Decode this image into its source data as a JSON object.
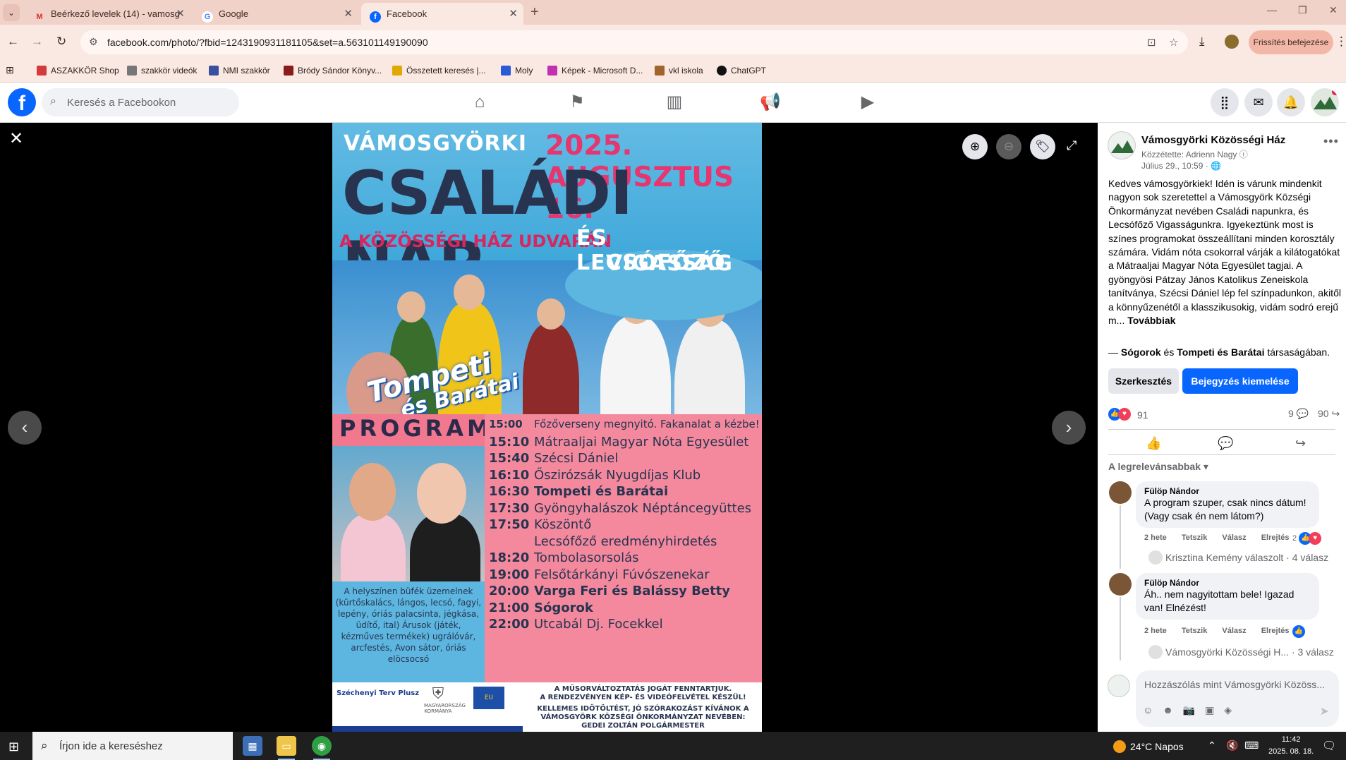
{
  "browser": {
    "tabs": [
      {
        "label": "Beérkező levelek (14) - vamosg",
        "icon": "gmail-icon"
      },
      {
        "label": "Google",
        "icon": "google-icon"
      },
      {
        "label": "Facebook",
        "icon": "facebook-icon"
      }
    ],
    "url": "facebook.com/photo/?fbid=1243190931181105&set=a.563101149190090",
    "refresh_button": "Frissítés befejezése",
    "bookmarks": [
      {
        "label": "ASZAKKÖR Shop",
        "color": "#d33b3b"
      },
      {
        "label": "szakkör videók",
        "color": "#777777"
      },
      {
        "label": "NMI szakkör",
        "color": "#3a4fa0"
      },
      {
        "label": "Bródy Sándor Könyv...",
        "color": "#8b1a1a"
      },
      {
        "label": "Összetett keresés |...",
        "color": "#e0a800"
      },
      {
        "label": "Moly",
        "color": "#2a5bd7"
      },
      {
        "label": "Képek - Microsoft D...",
        "color": "#c22fb0"
      },
      {
        "label": "vkl iskola",
        "color": "#a0652a"
      },
      {
        "label": "ChatGPT",
        "color": "#111111"
      }
    ]
  },
  "facebook": {
    "logo": "f",
    "search_placeholder": "Keresés a Facebookon"
  },
  "poster": {
    "town": "VÁMOSGYÖRKI",
    "date": "2025. AUGUSZTUS 16.",
    "title": "CSALÁDI NAP",
    "venue": "A KÖZÖSSÉGI HÁZ UDVARÁN",
    "sub1": "ÉS LECSÓFŐZŐ",
    "sub2": "VIGASSÁG",
    "logo1": "Tompeti",
    "logo2": "és Barátai",
    "program_label": "PROGRAM",
    "schedule": [
      {
        "time": "15:00",
        "event": "Főzőverseny megnyitó. Fakanalat a kézbe!",
        "bold": false
      },
      {
        "time": "15:10",
        "event": "Mátraaljai Magyar Nóta Egyesület",
        "bold": false
      },
      {
        "time": "15:40",
        "event": "Szécsi Dániel",
        "bold": false
      },
      {
        "time": "16:10",
        "event": "Őszirózsák Nyugdíjas Klub",
        "bold": false
      },
      {
        "time": "16:30",
        "event": "Tompeti és Barátai",
        "bold": true
      },
      {
        "time": "17:30",
        "event": "Gyöngyhalászok Néptáncegyüttes",
        "bold": false
      },
      {
        "time": "17:50",
        "event": "Köszöntő",
        "bold": false
      },
      {
        "time": "",
        "event": "Lecsófőző eredményhirdetés",
        "bold": false
      },
      {
        "time": "18:20",
        "event": "Tombolasorsolás",
        "bold": false
      },
      {
        "time": "19:00",
        "event": "Felsőtárkányi Fúvószenekar",
        "bold": false
      },
      {
        "time": "20:00",
        "event": "Varga Feri és Balássy Betty",
        "bold": true
      },
      {
        "time": "21:00",
        "event": "Sógorok",
        "bold": true
      },
      {
        "time": "22:00",
        "event": "Utcabál Dj. Focekkel",
        "bold": false
      }
    ],
    "info": "A helyszínen büfék üzemelnek (kürtőskalács, lángos, lecsó, fagyi, lepény, óriás palacsinta, jégkása, üdítő, ital) Árusok (játék, kézműves termékek) ugrálóvár, arcfestés, Avon sátor, óriás elöcsocsó",
    "footer_brand": "Széchenyi Terv Plusz",
    "footer_crest": "MAGYARORSZÁG KORMÁNYA",
    "footer_eu": "EU",
    "footer_line1": "A MŰSORVÁLTOZTATÁS JOGÁT FENNTARTJUK.",
    "footer_line2": "A RENDEZVÉNYEN KÉP- ÉS VIDEÓFELVÉTEL KÉSZÜL!",
    "footer_line3": "KELLEMES IDŐTÖLTÉST, JÓ SZÓRAKOZÁST KÍVÁNOK A VÁMOSGYÖRK KÖZSÉGI ÖNKORMÁNYZAT NEVÉBEN:",
    "footer_line4": "GEDEI ZOLTÁN POLGÁRMESTER"
  },
  "post": {
    "page_name": "Vámosgyörki Közösségi Ház",
    "posted_by": "Közzétette: Adrienn Nagy",
    "date": "Július 29., 10:59 ·",
    "text": "Kedves vámosgyörkiek! Idén is várunk mindenkit nagyon sok szeretettel a Vámosgyörk Községi Önkormányzat nevében Családi napunkra, és Lecsófőző Vigasságunkra. Igyekeztünk most is színes programokat összeállítani minden korosztály számára. Vidám nóta csokorral várják a kilátogatókat a Mátraaljai Magyar Nóta Egyesület tagjai. A gyöngyösi Pátzay János Katolikus Zeneiskola tanítványa, Szécsi Dániel lép fel színpadunkon, akitől a könnyűzenétől a klasszikusokig, vidám sodró erejű m...",
    "see_more": "Továbbiak",
    "with_prefix": "— ",
    "with_a": "Sógorok",
    "with_and": " és ",
    "with_b": "Tompeti és Barátai",
    "with_suffix": " társaságában.",
    "edit_button": "Szerkesztés",
    "boost_button": "Bejegyzés kiemelése",
    "reaction_count": "91",
    "comment_count": "9",
    "share_count": "90",
    "sort_label": "A legrelevánsabbak",
    "comments": [
      {
        "name": "Fülöp Nándor",
        "text": "A program szuper, csak nincs dátum! (Vagy csak én nem látom?)",
        "time": "2 hete",
        "like": "Tetszik",
        "reply": "Válasz",
        "hide": "Elrejtés",
        "likes": "2",
        "replies": "Krisztina Kemény válaszolt · 4 válasz"
      },
      {
        "name": "Fülöp Nándor",
        "text": "Áh.. nem nagyitottam bele! Igazad van! Elnézést!",
        "time": "2 hete",
        "like": "Tetszik",
        "reply": "Válasz",
        "hide": "Elrejtés",
        "likes": "",
        "replies": "Vámosgyörki Közösségi H... · 3 válasz"
      }
    ],
    "composer_placeholder": "Hozzászólás mint Vámosgyörki Közöss..."
  },
  "taskbar": {
    "search_placeholder": "Írjon ide a kereséshez",
    "weather": "24°C  Napos",
    "time": "11:42",
    "date": "2025. 08. 18."
  }
}
